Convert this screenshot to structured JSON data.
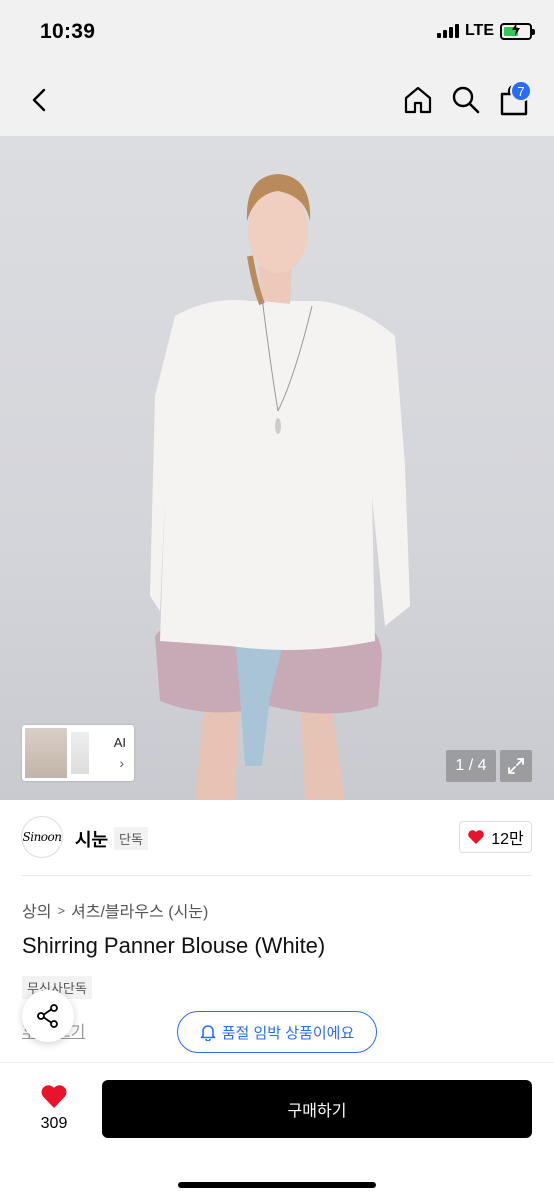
{
  "status_bar": {
    "time": "10:39",
    "network": "LTE",
    "battery_color": "#35c759"
  },
  "nav": {
    "back_icon": "chevron-left-icon",
    "home_icon": "home-icon",
    "search_icon": "search-icon",
    "cart_icon": "shopping-bag-icon",
    "cart_count": "7",
    "badge_color": "#2a6cf6"
  },
  "gallery": {
    "ai_label": "AI",
    "page_indicator": "1 / 4",
    "expand_icon": "expand-icon"
  },
  "brand": {
    "logo_text": "Sinoon",
    "name": "시눈",
    "tag": "단독",
    "like_count": "12만",
    "like_color": "#e8142b"
  },
  "product": {
    "breadcrumb": [
      "상의",
      "셔츠/블라우스 (시눈)"
    ],
    "title": "Shirring Panner Blouse (White)",
    "exclusive_tag": "무신사단독",
    "partial_text": "후기 보기",
    "soldout_notice": "품절 임박 상품이에요"
  },
  "bottom_bar": {
    "wish_count": "309",
    "buy_label": "구매하기"
  }
}
